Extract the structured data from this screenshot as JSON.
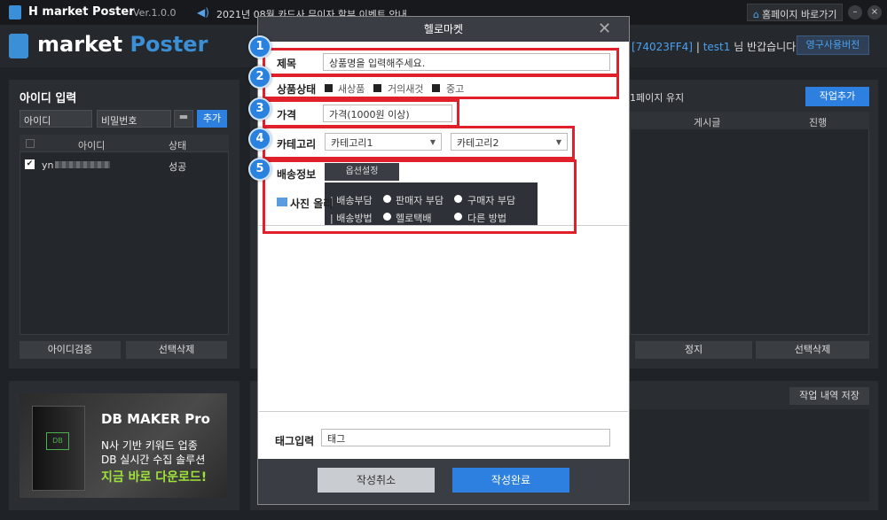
{
  "titlebar": {
    "app_title": "H market Poster",
    "version": "Ver.1.0.0",
    "notice": "2021년 08월 카드사 무이자 할부 이벤트 안내",
    "home_button": "홈페이지 바로가기",
    "minimize": "–",
    "close": "×"
  },
  "header": {
    "logo_h": "H",
    "logo_word1": "market",
    "logo_word2": "Poster",
    "user_code": "[74023FF4]",
    "separator": "|",
    "user_name": "test1",
    "greeting": "님 반갑습니다!",
    "permanent_button": "영구사용버전"
  },
  "left_panel": {
    "title": "아이디 입력",
    "id_value": "아이디",
    "pw_value": "비밀번호",
    "add_button": "추가",
    "columns": [
      "아이디",
      "상태"
    ],
    "rows": [
      {
        "id_prefix": "yn",
        "status": "성공",
        "checked": "✔"
      }
    ],
    "verify_button": "아이디검증",
    "delete_button": "선택삭제"
  },
  "ad": {
    "title": "DB MAKER Pro",
    "box_logo": "DB",
    "line1": "N사 기반 키워드 업종",
    "line2": "DB 실시간 수집 솔루션",
    "line3": "지금 바로 다운로드!"
  },
  "right_panel": {
    "keep_label": "1페이지 유지",
    "job_add_button": "작업추가",
    "columns": [
      "게시글",
      "진행"
    ],
    "stop_button": "정지",
    "delete_button": "선택삭제",
    "save_log_button": "작업 내역 저장"
  },
  "modal": {
    "title": "헬로마켓",
    "close": "✕",
    "fields": {
      "title_label": "제목",
      "title_placeholder": "상품명을 입력해주세요.",
      "condition_label": "상품상태",
      "condition_options": [
        "새상품",
        "거의새것",
        "중고"
      ],
      "price_label": "가격",
      "price_placeholder": "가격(1000원 이상)",
      "category_label": "카테고리",
      "category1": "카테고리1",
      "category2": "카테고리2",
      "shipping_label": "배송정보",
      "option_button": "옵션설정",
      "ship_cost_label": "| 배송부담",
      "ship_cost_options": [
        "판매자 부담",
        "구매자 부담"
      ],
      "ship_method_label": "| 배송방법",
      "ship_method_options": [
        "헬로택배",
        "다른 방법"
      ],
      "photo_label": "사진 올리",
      "tag_label": "태그입력",
      "tag_value": "태그"
    },
    "cancel_button": "작성취소",
    "done_button": "작성완료"
  },
  "badges": [
    "1",
    "2",
    "3",
    "4",
    "5"
  ],
  "colors": {
    "accent": "#2d7fe0",
    "highlight_box": "#e0202a",
    "badge": "#2a82de"
  }
}
